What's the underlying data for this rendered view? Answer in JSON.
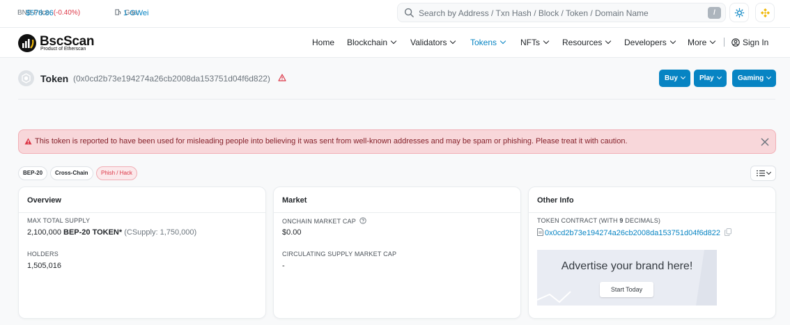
{
  "topbar": {
    "price_label": "BNB Price:",
    "price_value": "$578.86",
    "price_change": "(-0.40%)",
    "gas_label": "Gas:",
    "gas_value": "1 GWei",
    "search_placeholder": "Search by Address / Txn Hash / Block / Token / Domain Name",
    "search_shortcut": "/"
  },
  "brand": {
    "name": "BscScan",
    "subtitle": "Product of Etherscan"
  },
  "nav": {
    "home": "Home",
    "blockchain": "Blockchain",
    "validators": "Validators",
    "tokens": "Tokens",
    "nfts": "NFTs",
    "resources": "Resources",
    "developers": "Developers",
    "more": "More",
    "sign_in": "Sign In"
  },
  "token": {
    "title": "Token",
    "address_display": "(0x0cd2b73e194274a26cb2008da153751d04f6d822)"
  },
  "actions": {
    "buy": "Buy",
    "play": "Play",
    "gaming": "Gaming"
  },
  "alert": {
    "text": "This token is reported to have been used for misleading people into believing it was sent from well-known addresses and may be spam or phishing. Please treat it with caution."
  },
  "badges": {
    "b1": "BEP-20",
    "b2": "Cross-Chain",
    "b3": "Phish / Hack"
  },
  "overview": {
    "title": "Overview",
    "supply_label": "MAX TOTAL SUPPLY",
    "supply_amount": "2,100,000",
    "supply_token": "BEP-20 TOKEN*",
    "supply_csupply": "(CSupply: 1,750,000)",
    "holders_label": "HOLDERS",
    "holders_value": "1,505,016"
  },
  "market": {
    "title": "Market",
    "cap_label": "ONCHAIN MARKET CAP",
    "cap_value": "$0.00",
    "circ_label": "CIRCULATING SUPPLY MARKET CAP",
    "circ_value": "-"
  },
  "other": {
    "title": "Other Info",
    "contract_label_pre": "TOKEN CONTRACT (WITH",
    "contract_decimals": "9",
    "contract_label_post": "DECIMALS)",
    "contract_address": "0x0cd2b73e194274a26cb2008da153751d04f6d822",
    "ad_text": "Advertise your brand here!",
    "ad_button": "Start Today"
  },
  "colors": {
    "accent": "#0784c3",
    "danger": "#dc3545",
    "alert_bg": "#f8d7da",
    "brand_gold": "#f0b90b"
  }
}
